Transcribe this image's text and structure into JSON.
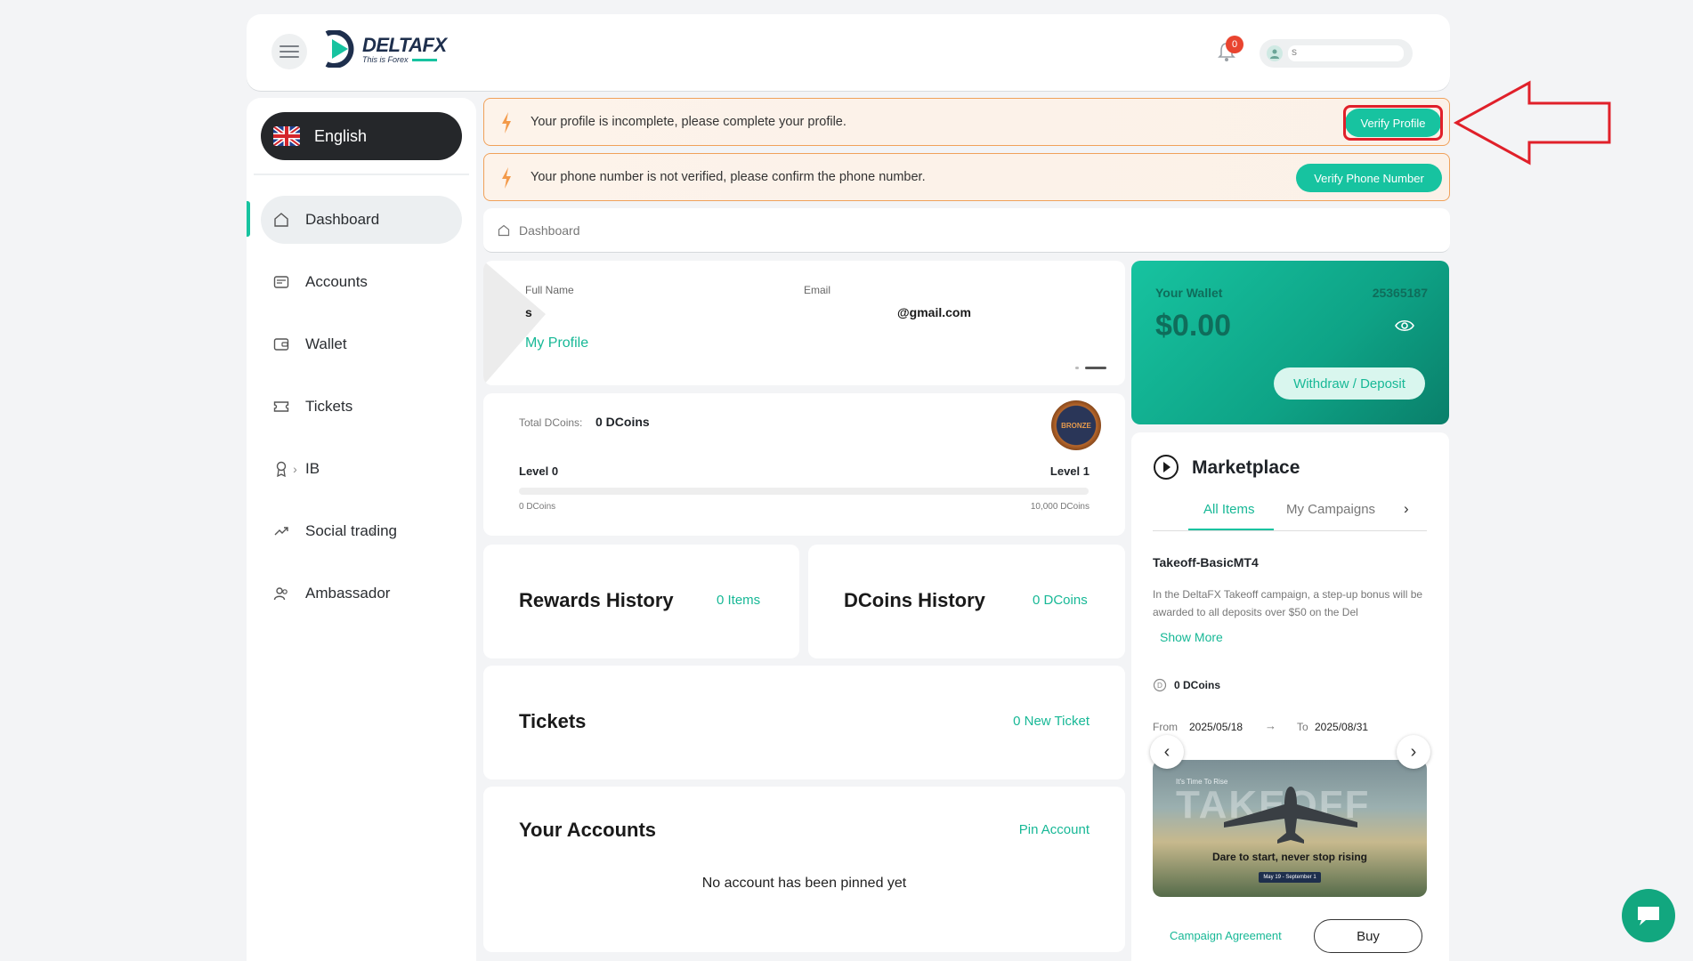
{
  "header": {
    "brand_name": "DELTAFX",
    "brand_tagline": "This is Forex",
    "notification_count": "0",
    "user_name": "s"
  },
  "sidebar": {
    "language": "English",
    "items": [
      {
        "label": "Dashboard",
        "icon": "home-icon"
      },
      {
        "label": "Accounts",
        "icon": "accounts-icon"
      },
      {
        "label": "Wallet",
        "icon": "wallet-icon"
      },
      {
        "label": "Tickets",
        "icon": "ticket-icon"
      },
      {
        "label": "IB",
        "icon": "award-icon"
      },
      {
        "label": "Social trading",
        "icon": "trend-icon"
      },
      {
        "label": "Ambassador",
        "icon": "people-icon"
      }
    ]
  },
  "alerts": {
    "profile_text": "Your profile is incomplete, please complete your profile.",
    "profile_button": "Verify Profile",
    "phone_text": "Your phone number is not verified, please confirm the phone number.",
    "phone_button": "Verify Phone Number"
  },
  "breadcrumb": "Dashboard",
  "profile": {
    "fullname_label": "Full Name",
    "fullname_value": "s",
    "email_label": "Email",
    "email_value": "@gmail.com",
    "my_profile_link": "My Profile"
  },
  "dcoins": {
    "total_label": "Total DCoins:",
    "total_value": "0 DCoins",
    "level_current": "Level 0",
    "level_next": "Level 1",
    "range_min": "0 DCoins",
    "range_max": "10,000 DCoins",
    "badge": "BRONZE",
    "progress_fraction": 0
  },
  "rewards": {
    "title": "Rewards History",
    "count": "0 Items"
  },
  "dcoins_history": {
    "title": "DCoins History",
    "count": "0 DCoins"
  },
  "tickets": {
    "title": "Tickets",
    "action": "0 New Ticket"
  },
  "accounts": {
    "title": "Your Accounts",
    "action": "Pin Account",
    "empty": "No account has been pinned yet"
  },
  "wallet": {
    "title": "Your Wallet",
    "id": "25365187",
    "balance": "$0.00",
    "button": "Withdraw / Deposit"
  },
  "marketplace": {
    "title": "Marketplace",
    "tabs": [
      "All Items",
      "My Campaigns"
    ],
    "item_title": "Takeoff-BasicMT4",
    "item_desc": "In the DeltaFX Takeoff campaign, a step-up bonus will be awarded to all deposits over $50 on the Del",
    "show_more": "Show More",
    "dcoins": "0 DCoins",
    "from_label": "From",
    "from_date": "2025/05/18",
    "to_label": "To",
    "to_date": "2025/08/31",
    "banner_kicker": "It's Time To Rise",
    "banner_title": "TAKEOFF",
    "banner_caption": "Dare to start, never stop rising",
    "banner_dates": "May 19 - September 1",
    "agreement_link": "Campaign Agreement",
    "buy_button": "Buy"
  },
  "colors": {
    "accent": "#17c3a0",
    "alert_border": "#f0a15a",
    "annotation": "#e0202a",
    "sidebar_lang_bg": "#25272a"
  }
}
